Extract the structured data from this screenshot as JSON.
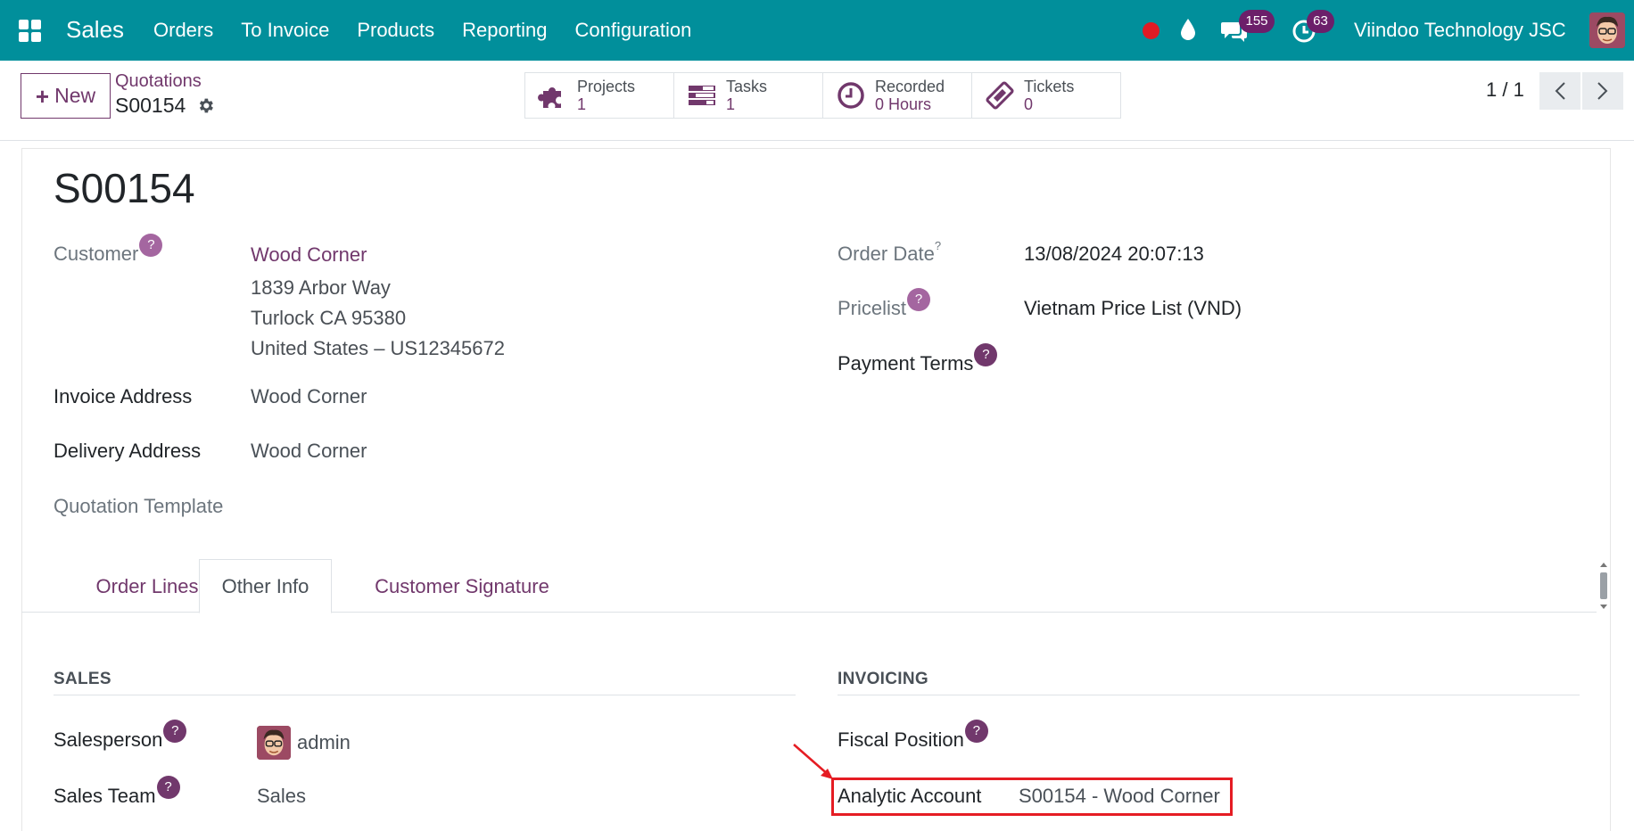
{
  "navbar": {
    "app_name": "Sales",
    "menu": [
      "Orders",
      "To Invoice",
      "Products",
      "Reporting",
      "Configuration"
    ],
    "chat_count": "155",
    "activity_count": "63",
    "company": "Viindoo Technology JSC",
    "bg_color": "#018f9b"
  },
  "control": {
    "new_label": "New",
    "breadcrumb_parent": "Quotations",
    "breadcrumb_current": "S00154",
    "stats": [
      {
        "icon": "puzzle-icon",
        "label": "Projects",
        "value": "1"
      },
      {
        "icon": "tasks-icon",
        "label": "Tasks",
        "value": "1"
      },
      {
        "icon": "clock-icon",
        "label": "Recorded",
        "value": "0 Hours"
      },
      {
        "icon": "ticket-icon",
        "label": "Tickets",
        "value": "0"
      }
    ],
    "pager": "1 / 1"
  },
  "record": {
    "title": "S00154",
    "customer_label": "Customer",
    "customer_name": "Wood Corner",
    "customer_address": [
      "1839 Arbor Way",
      "Turlock CA 95380",
      "United States – US12345672"
    ],
    "invoice_address_label": "Invoice Address",
    "invoice_address": "Wood Corner",
    "delivery_address_label": "Delivery Address",
    "delivery_address": "Wood Corner",
    "quotation_template_label": "Quotation Template",
    "order_date_label": "Order Date",
    "order_date": "13/08/2024 20:07:13",
    "pricelist_label": "Pricelist",
    "pricelist": "Vietnam Price List (VND)",
    "payment_terms_label": "Payment Terms",
    "help_mark": "?"
  },
  "tabs": [
    "Order Lines",
    "Other Info",
    "Customer Signature"
  ],
  "other_info": {
    "sales_section": "SALES",
    "salesperson_label": "Salesperson",
    "salesperson": "admin",
    "sales_team_label": "Sales Team",
    "sales_team": "Sales",
    "invoicing_section": "INVOICING",
    "fiscal_position_label": "Fiscal Position",
    "analytic_account_label": "Analytic Account",
    "analytic_account": "S00154 - Wood Corner"
  }
}
